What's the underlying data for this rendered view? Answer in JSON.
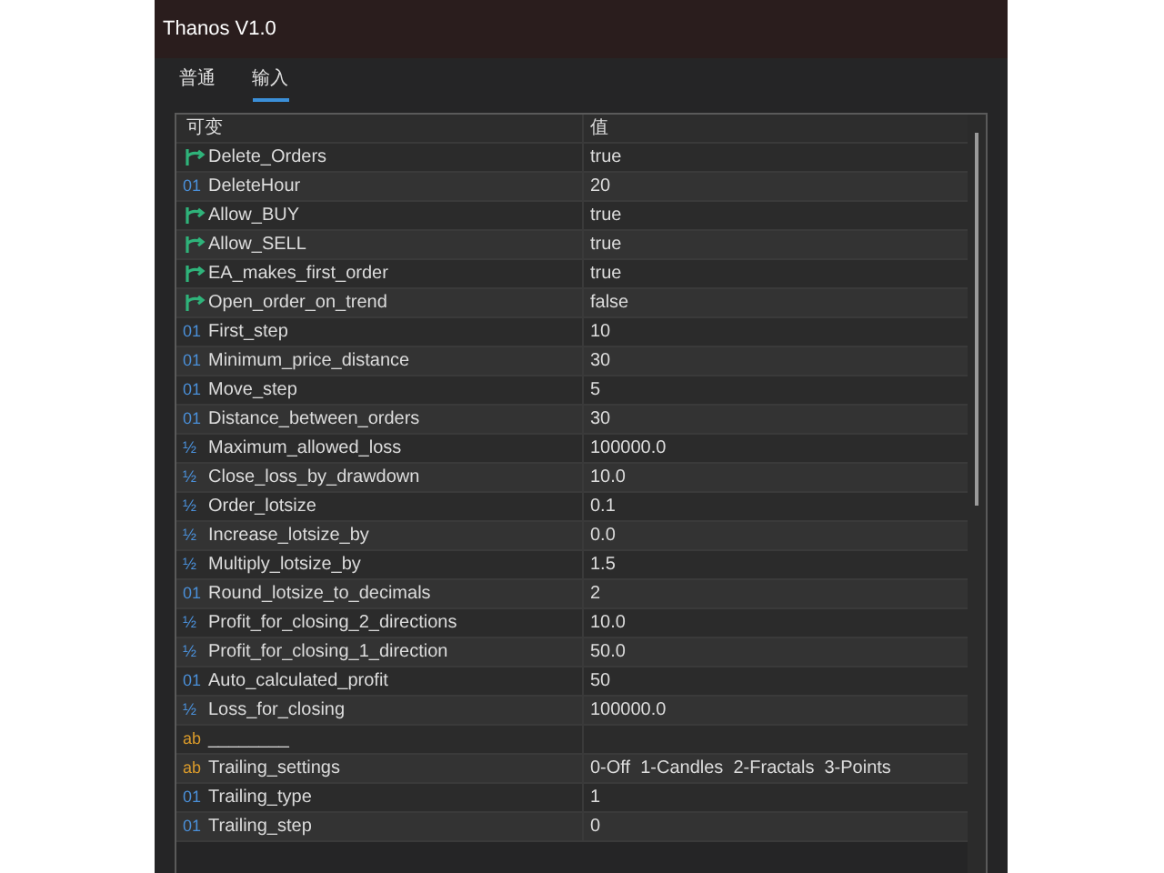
{
  "window": {
    "title": "Thanos V1.0"
  },
  "tabs": [
    {
      "label": "普通",
      "selected": false
    },
    {
      "label": "输入",
      "selected": true
    }
  ],
  "table": {
    "columns": [
      "可变",
      "值"
    ],
    "rows": [
      {
        "kind": "bool",
        "name": "Delete_Orders",
        "value": "true"
      },
      {
        "kind": "int",
        "badge": "01",
        "name": "DeleteHour",
        "value": "20"
      },
      {
        "kind": "bool",
        "name": "Allow_BUY",
        "value": "true"
      },
      {
        "kind": "bool",
        "name": "Allow_SELL",
        "value": "true"
      },
      {
        "kind": "bool",
        "name": "EA_makes_first_order",
        "value": "true"
      },
      {
        "kind": "bool",
        "name": "Open_order_on_trend",
        "value": "false"
      },
      {
        "kind": "int",
        "badge": "01",
        "name": "First_step",
        "value": "10"
      },
      {
        "kind": "int",
        "badge": "01",
        "name": "Minimum_price_distance",
        "value": "30"
      },
      {
        "kind": "int",
        "badge": "01",
        "name": "Move_step",
        "value": "5"
      },
      {
        "kind": "int",
        "badge": "01",
        "name": "Distance_between_orders",
        "value": "30"
      },
      {
        "kind": "double",
        "badge": "½",
        "name": "Maximum_allowed_loss",
        "value": "100000.0"
      },
      {
        "kind": "double",
        "badge": "½",
        "name": "Close_loss_by_drawdown",
        "value": "10.0"
      },
      {
        "kind": "double",
        "badge": "½",
        "name": "Order_lotsize",
        "value": "0.1"
      },
      {
        "kind": "double",
        "badge": "½",
        "name": "Increase_lotsize_by",
        "value": "0.0"
      },
      {
        "kind": "double",
        "badge": "½",
        "name": "Multiply_lotsize_by",
        "value": "1.5"
      },
      {
        "kind": "int",
        "badge": "01",
        "name": "Round_lotsize_to_decimals",
        "value": "2"
      },
      {
        "kind": "double",
        "badge": "½",
        "name": "Profit_for_closing_2_directions",
        "value": "10.0"
      },
      {
        "kind": "double",
        "badge": "½",
        "name": "Profit_for_closing_1_direction",
        "value": "50.0"
      },
      {
        "kind": "int",
        "badge": "01",
        "name": "Auto_calculated_profit",
        "value": "50"
      },
      {
        "kind": "double",
        "badge": "½",
        "name": "Loss_for_closing",
        "value": "100000.0"
      },
      {
        "kind": "string",
        "badge": "ab",
        "name": "________"
      },
      {
        "kind": "string",
        "badge": "ab",
        "name": "Trailing_settings",
        "value": "0-Off  1-Candles  2-Fractals  3-Points"
      },
      {
        "kind": "int",
        "badge": "01",
        "name": "Trailing_type",
        "value": "1"
      },
      {
        "kind": "int",
        "badge": "01",
        "name": "Trailing_step",
        "value": "0"
      }
    ]
  }
}
